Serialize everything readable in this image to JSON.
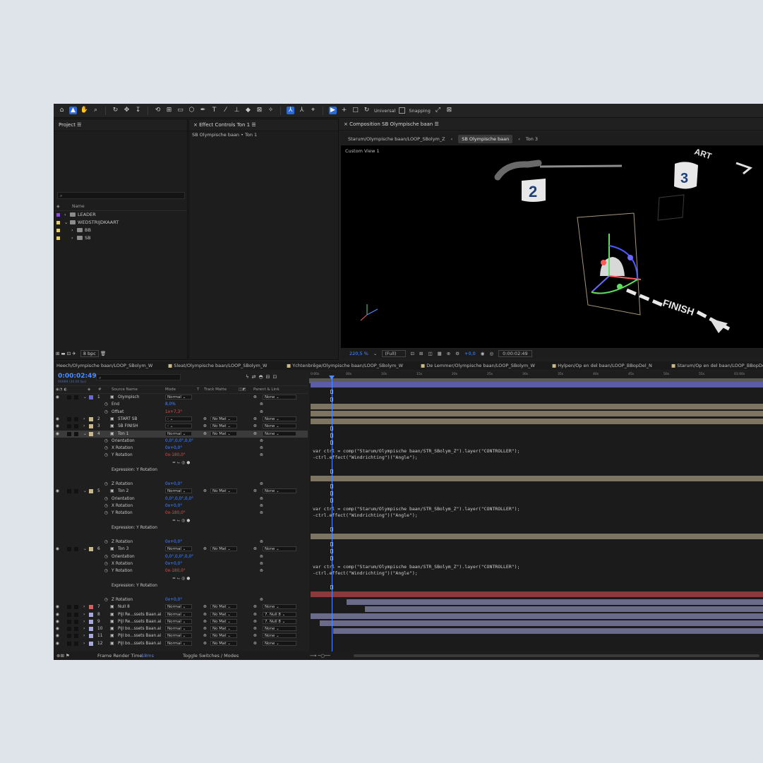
{
  "toolbar": {
    "axis_mode": "Universal",
    "snapping": "Snapping"
  },
  "panels": {
    "project_title": "Project",
    "effect_controls_title": "Effect Controls Ton 1",
    "effect_controls_sub": "SB Olympische baan • Ton 1",
    "composition_title": "Composition SB Olympische baan"
  },
  "project": {
    "column_name": "Name",
    "items": [
      {
        "name": "LEADER",
        "color": "#8a4fd6"
      },
      {
        "name": "WEDSTRIJDKAART",
        "color": "#e0d25a"
      },
      {
        "name": "BB",
        "color": "#e0d25a"
      },
      {
        "name": "SB",
        "color": "#e0d25a"
      }
    ],
    "bpc": "8 bpc"
  },
  "viewer": {
    "tabs": [
      "Starum/Olympische baan/LOOP_SBolym_Z",
      "SB Olympische baan",
      "Ton 3"
    ],
    "view_label": "Custom View 1",
    "labels": {
      "start_arrow": "ART",
      "finish": "FINISH",
      "num2": "2",
      "num3": "3"
    },
    "zoom": "220,5 %",
    "resolution": "(Full)",
    "exposure": "+0,0",
    "timecode": "0:00:02:49"
  },
  "comp_tabs": [
    "Heech/Olympische baan/LOOP_SBolym_W",
    "Sleat/Olympische baan/LOOP_SBolym_W",
    "Ychtenbrêge/Olympische baan/LOOP_SBolym_W",
    "De Lemmer/Olympische baan/LOOP_SBolym_W",
    "Hylpen/Op en del baan/LOOP_BBopDel_N",
    "Starum/Op en del baan/LOOP_BBopDel("
  ],
  "timeline": {
    "timecode": "0:00:02:49",
    "subtime": "00089 (30.00 fps)",
    "headers": {
      "source": "Source Name",
      "mode": "Mode",
      "t": "T",
      "track": "Track Matte",
      "parent": "Parent & Link"
    },
    "ruler_ticks": [
      "0:00s",
      "00s",
      "10s",
      "15s",
      "20s",
      "25s",
      "30s",
      "35s",
      "40s",
      "45s",
      "50s",
      "55s",
      "01:00s"
    ],
    "rows": [
      {
        "kind": "layer",
        "num": "1",
        "name": "Olympisch",
        "mode": "Normal",
        "track": "",
        "parent": "None",
        "color": "#6a6ad6",
        "bar": "#5b5da8",
        "bar_from": 0,
        "bar_to": 1
      },
      {
        "kind": "prop",
        "name": "End",
        "value": "8,0%",
        "vclass": "bvals"
      },
      {
        "kind": "prop",
        "name": "Offset",
        "value": "1x+7,3°",
        "vclass": "rvals"
      },
      {
        "kind": "layer",
        "num": "2",
        "name": "START SB",
        "mode": "-",
        "track": "No Mat",
        "parent": "None",
        "color": "#c9b98a",
        "bar": "#7d7461",
        "bar_from": 0,
        "bar_to": 1
      },
      {
        "kind": "layer",
        "num": "3",
        "name": "SB FINISH",
        "mode": "-",
        "track": "No Mat",
        "parent": "None",
        "color": "#c9b98a",
        "bar": "#7d7461",
        "bar_from": 0,
        "bar_to": 1
      },
      {
        "kind": "layer",
        "num": "4",
        "name": "Ton 1",
        "mode": "Normal",
        "track": "No Mat",
        "parent": "None",
        "color": "#c9b98a",
        "bar": "#7d7461",
        "bar_from": 0,
        "bar_to": 1,
        "selected": true
      },
      {
        "kind": "prop",
        "name": "Orientation",
        "value": "0,0°,0,0°,0,0°",
        "vclass": "bvals"
      },
      {
        "kind": "prop",
        "name": "X Rotation",
        "value": "0x+0,0°",
        "vclass": "bvals"
      },
      {
        "kind": "prop",
        "name": "Y Rotation",
        "value": "0x-180,0°",
        "vclass": "rvals"
      },
      {
        "kind": "expr",
        "label": "Expression: Y Rotation",
        "code": "var ctrl = comp(\"Starum/Olympische baan/STR_SBolym_Z\").layer(\"CONTROLLER\");\n-ctrl.effect(\"Windrichting\")(\"Angle\");"
      },
      {
        "kind": "prop",
        "name": "Z Rotation",
        "value": "0x+0,0°",
        "vclass": "bvals"
      },
      {
        "kind": "layer",
        "num": "5",
        "name": "Ton 2",
        "mode": "Normal",
        "track": "No Mat",
        "parent": "None",
        "color": "#c9b98a",
        "bar": "#7d7461",
        "bar_from": 0,
        "bar_to": 1
      },
      {
        "kind": "prop",
        "name": "Orientation",
        "value": "0,0°,0,0°,0,0°",
        "vclass": "bvals"
      },
      {
        "kind": "prop",
        "name": "X Rotation",
        "value": "0x+0,0°",
        "vclass": "bvals"
      },
      {
        "kind": "prop",
        "name": "Y Rotation",
        "value": "0x-180,0°",
        "vclass": "rvals"
      },
      {
        "kind": "expr",
        "label": "Expression: Y Rotation",
        "code": "var ctrl = comp(\"Starum/Olympische baan/STR_SBolym_Z\").layer(\"CONTROLLER\");\n-ctrl.effect(\"Windrichting\")(\"Angle\");"
      },
      {
        "kind": "prop",
        "name": "Z Rotation",
        "value": "0x+0,0°",
        "vclass": "bvals"
      },
      {
        "kind": "layer",
        "num": "6",
        "name": "Ton 3",
        "mode": "Normal",
        "track": "No Mat",
        "parent": "None",
        "color": "#c9b98a",
        "bar": "#7d7461",
        "bar_from": 0,
        "bar_to": 1
      },
      {
        "kind": "prop",
        "name": "Orientation",
        "value": "0,0°,0,0°,0,0°",
        "vclass": "bvals"
      },
      {
        "kind": "prop",
        "name": "X Rotation",
        "value": "0x+0,0°",
        "vclass": "bvals"
      },
      {
        "kind": "prop",
        "name": "Y Rotation",
        "value": "0x-180,0°",
        "vclass": "rvals"
      },
      {
        "kind": "expr",
        "label": "Expression: Y Rotation",
        "code": "var ctrl = comp(\"Starum/Olympische baan/STR_SBolym_Z\").layer(\"CONTROLLER\");\n-ctrl.effect(\"Windrichting\")(\"Angle\");"
      },
      {
        "kind": "prop",
        "name": "Z Rotation",
        "value": "0x+0,0°",
        "vclass": "bvals"
      },
      {
        "kind": "layer",
        "num": "7",
        "name": "Null 8",
        "mode": "Normal",
        "track": "No Mat",
        "parent": "None",
        "color": "#d66060",
        "bar": "#8a3a3a",
        "bar_from": 0,
        "bar_to": 1
      },
      {
        "kind": "layer",
        "num": "8",
        "name": "Pijl Re...ssets Baan.ai",
        "mode": "Normal",
        "track": "No Mat",
        "parent": "7. Null 8",
        "color": "#a8a8e0",
        "bar": "#6a6a8a",
        "bar_from": 0.08,
        "bar_to": 1
      },
      {
        "kind": "layer",
        "num": "9",
        "name": "Pijl Re...ssets Baan.ai",
        "mode": "Normal",
        "track": "No Mat",
        "parent": "7. Null 8",
        "color": "#a8a8e0",
        "bar": "#6a6a8a",
        "bar_from": 0.12,
        "bar_to": 1
      },
      {
        "kind": "layer",
        "num": "10",
        "name": "Pijl bo...ssets Baan.ai",
        "mode": "Normal",
        "track": "No Mat",
        "parent": "None",
        "color": "#a8a8e0",
        "bar": "#6a6a8a",
        "bar_from": 0.0,
        "bar_to": 1
      },
      {
        "kind": "layer",
        "num": "11",
        "name": "Pijl bo...ssets Baan.ai",
        "mode": "Normal",
        "track": "No Mat",
        "parent": "None",
        "color": "#a8a8e0",
        "bar": "#6a6a8a",
        "bar_from": 0.02,
        "bar_to": 1
      },
      {
        "kind": "layer",
        "num": "12",
        "name": "Pijl bo...ssets Baan.ai",
        "mode": "Normal",
        "track": "No Mat",
        "parent": "None",
        "color": "#a8a8e0",
        "bar": "#6a6a8a",
        "bar_from": 0.05,
        "bar_to": 1
      }
    ]
  },
  "status": {
    "render_label": "Frame Render Time:",
    "render_value": "18ms",
    "toggle": "Toggle Switches / Modes"
  }
}
